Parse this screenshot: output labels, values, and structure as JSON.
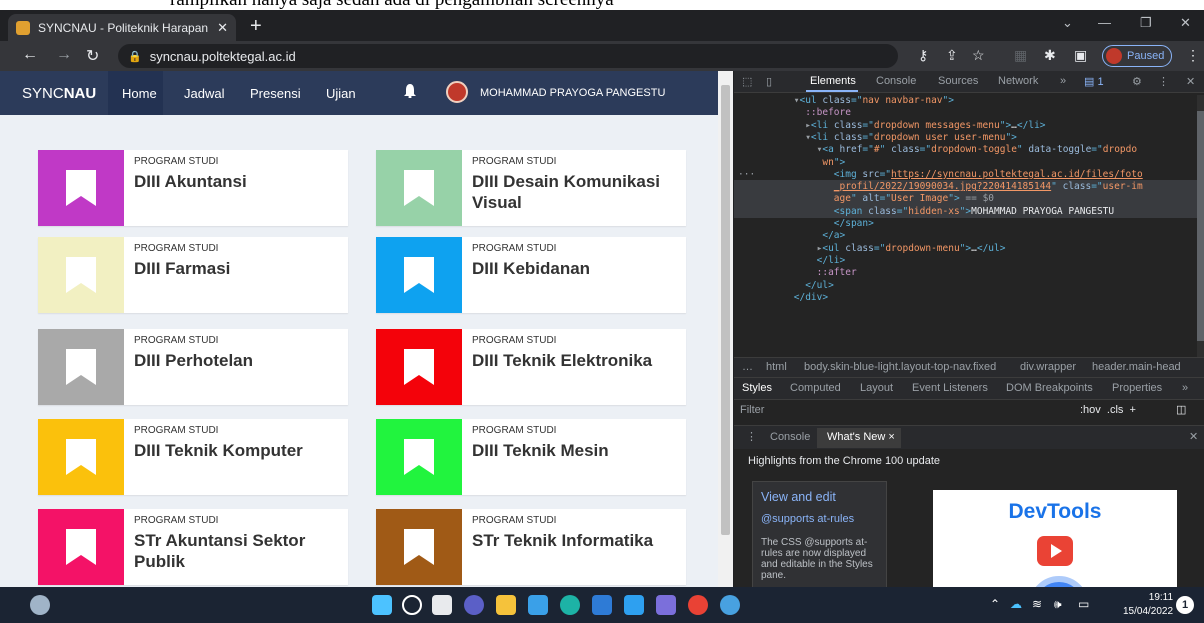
{
  "top_caption": "rampilkan hanya saja sedah ada di pengambilan screennya",
  "browser": {
    "tab_title": "SYNCNAU - Politeknik Harapan B",
    "tab_close": "✕",
    "new_tab": "+",
    "url": "syncnau.poltektegal.ac.id",
    "profile_status": "Paused"
  },
  "app": {
    "brand_prefix": "SYNC",
    "brand_bold": "NAU",
    "nav": [
      "Home",
      "Jadwal",
      "Presensi",
      "Ujian"
    ],
    "user_name": "MOHAMMAD PRAYOGA PANGESTU",
    "card_caption": "PROGRAM STUDI",
    "programs": [
      {
        "name": "DIII Akuntansi",
        "color": "#c039c6"
      },
      {
        "name": "DIII Desain Komunikasi Visual",
        "color": "#97d2a8"
      },
      {
        "name": "DIII Farmasi",
        "color": "#f2f0c2"
      },
      {
        "name": "DIII Kebidanan",
        "color": "#0ea2f0"
      },
      {
        "name": "DIII Perhotelan",
        "color": "#a9a9a9"
      },
      {
        "name": "DIII Teknik Elektronika",
        "color": "#f4020a"
      },
      {
        "name": "DIII Teknik Komputer",
        "color": "#fbc10c"
      },
      {
        "name": "DIII Teknik Mesin",
        "color": "#21f43e"
      },
      {
        "name": "STr Akuntansi Sektor Publik",
        "color": "#f41267"
      },
      {
        "name": "STr Teknik Informatika",
        "color": "#a05a16"
      }
    ]
  },
  "devtools": {
    "tabs": [
      "Elements",
      "Console",
      "Sources",
      "Network",
      "»"
    ],
    "issues_count": "1",
    "code_lines": [
      {
        "indent": 8,
        "parts": [
          [
            "dim",
            "▾"
          ],
          [
            "tag",
            "<ul "
          ],
          [
            "attr",
            "class"
          ],
          [
            "tag",
            "=\""
          ],
          [
            "val",
            "nav navbar-nav"
          ],
          [
            "tag",
            "\">"
          ]
        ]
      },
      {
        "indent": 10,
        "parts": [
          [
            "pseudo",
            "::before"
          ]
        ]
      },
      {
        "indent": 10,
        "parts": [
          [
            "dim",
            "▸"
          ],
          [
            "tag",
            "<li "
          ],
          [
            "attr",
            "class"
          ],
          [
            "tag",
            "=\""
          ],
          [
            "val",
            "dropdown messages-menu"
          ],
          [
            "tag",
            "\">"
          ],
          [
            "txt",
            "…"
          ],
          [
            "tag",
            "</li>"
          ]
        ]
      },
      {
        "indent": 10,
        "parts": [
          [
            "dim",
            "▾"
          ],
          [
            "tag",
            "<li "
          ],
          [
            "attr",
            "class"
          ],
          [
            "tag",
            "=\""
          ],
          [
            "val",
            "dropdown user user-menu"
          ],
          [
            "tag",
            "\">"
          ]
        ]
      },
      {
        "indent": 12,
        "parts": [
          [
            "dim",
            "▾"
          ],
          [
            "tag",
            "<a "
          ],
          [
            "attr",
            "href"
          ],
          [
            "tag",
            "=\""
          ],
          [
            "val",
            "#"
          ],
          [
            "tag",
            "\" "
          ],
          [
            "attr",
            "class"
          ],
          [
            "tag",
            "=\""
          ],
          [
            "val",
            "dropdown-toggle"
          ],
          [
            "tag",
            "\" "
          ],
          [
            "attr",
            "data-toggle"
          ],
          [
            "tag",
            "=\""
          ],
          [
            "val",
            "dropdo"
          ]
        ]
      },
      {
        "indent": 13,
        "parts": [
          [
            "val",
            "wn"
          ],
          [
            "tag",
            "\">"
          ]
        ]
      },
      {
        "indent": 15,
        "parts": [
          [
            "tag",
            "<img "
          ],
          [
            "attr",
            "src"
          ],
          [
            "tag",
            "=\""
          ],
          [
            "link",
            "https://syncnau.poltektegal.ac.id/files/foto"
          ]
        ]
      },
      {
        "indent": 15,
        "parts": [
          [
            "link",
            "_profil/2022/19090034.jpg?220414185144"
          ],
          [
            "tag",
            "\" "
          ],
          [
            "attr",
            "class"
          ],
          [
            "tag",
            "=\""
          ],
          [
            "val",
            "user-im"
          ]
        ]
      },
      {
        "indent": 15,
        "parts": [
          [
            "val",
            "age"
          ],
          [
            "tag",
            "\" "
          ],
          [
            "attr",
            "alt"
          ],
          [
            "tag",
            "=\""
          ],
          [
            "val",
            "User Image"
          ],
          [
            "tag",
            "\">"
          ],
          [
            "dim",
            " == $0"
          ]
        ]
      },
      {
        "indent": 15,
        "parts": [
          [
            "tag",
            "<span "
          ],
          [
            "attr",
            "class"
          ],
          [
            "tag",
            "=\""
          ],
          [
            "val",
            "hidden-xs"
          ],
          [
            "tag",
            "\">"
          ],
          [
            "txt",
            "MOHAMMAD PRAYOGA PANGESTU"
          ]
        ]
      },
      {
        "indent": 15,
        "parts": [
          [
            "tag",
            "</span>"
          ]
        ]
      },
      {
        "indent": 13,
        "parts": [
          [
            "tag",
            "</a>"
          ]
        ]
      },
      {
        "indent": 12,
        "parts": [
          [
            "dim",
            "▸"
          ],
          [
            "tag",
            "<ul "
          ],
          [
            "attr",
            "class"
          ],
          [
            "tag",
            "=\""
          ],
          [
            "val",
            "dropdown-menu"
          ],
          [
            "tag",
            "\">"
          ],
          [
            "txt",
            "…"
          ],
          [
            "tag",
            "</ul>"
          ]
        ]
      },
      {
        "indent": 12,
        "parts": [
          [
            "tag",
            "</li>"
          ]
        ]
      },
      {
        "indent": 12,
        "parts": [
          [
            "pseudo",
            "::after"
          ]
        ]
      },
      {
        "indent": 10,
        "parts": [
          [
            "tag",
            "</ul>"
          ]
        ]
      },
      {
        "indent": 8,
        "parts": [
          [
            "tag",
            "</div>"
          ]
        ]
      }
    ],
    "breadcrumbs": [
      "html",
      "body.skin-blue-light.layout-top-nav.fixed",
      "div.wrapper",
      "header.main-head"
    ],
    "subtabs": [
      "Styles",
      "Computed",
      "Layout",
      "Event Listeners",
      "DOM Breakpoints",
      "Properties",
      "»"
    ],
    "filter_placeholder": "Filter",
    "filter_tools": ":hov  .cls  +",
    "drawer_tabs": [
      "Console",
      "What's New ×"
    ],
    "highlights": "Highlights from the Chrome 100 update",
    "news_title": "View and edit",
    "news_sub": "@supports at-rules",
    "news_body": "The CSS @supports at-rules are now displayed and editable in the Styles pane.",
    "promo_title": "DevTools"
  },
  "taskbar": {
    "time": "19:11",
    "date": "15/04/2022",
    "notification_count": "1"
  }
}
